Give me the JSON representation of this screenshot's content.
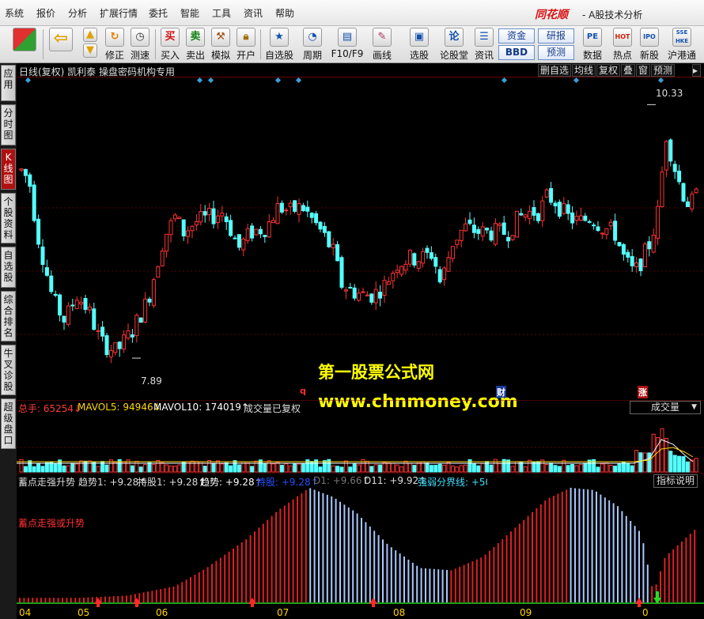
{
  "menu": [
    "系统",
    "报价",
    "分析",
    "扩展行情",
    "委托",
    "智能",
    "工具",
    "资讯",
    "帮助"
  ],
  "brand": "同花顺",
  "app_title": "- A股技术分析",
  "toolbar": {
    "items": [
      "修正",
      "测速",
      "买入",
      "卖出",
      "模拟",
      "开户",
      "自选股",
      "周期",
      "F10/F9",
      "画线",
      "选股",
      "论股堂",
      "资讯",
      "数据",
      "热点",
      "新股",
      "沪港通"
    ],
    "buy_glyph": "买",
    "sell_glyph": "卖",
    "lun_glyph": "论",
    "zijin": "资金",
    "bbd": "BBD",
    "yanbao": "研报",
    "yuce": "预测",
    "pe_glyph": "PE",
    "hot_glyph": "HOT",
    "ipo_glyph": "IPO",
    "hk_glyph": "SSE HKE"
  },
  "sidebar": [
    "应用",
    "分时图",
    "K线图",
    "个股资料",
    "自选股",
    "综合排名",
    "牛叉诊股",
    "超级盘口"
  ],
  "chart_header": {
    "title": "日线(复权) 凯利泰 操盘密码机构专用",
    "buttons": [
      "删自选",
      "均线",
      "复权",
      "叠",
      "窗",
      "预测"
    ]
  },
  "kline": {
    "high_label": "10.33",
    "low_label": "7.89",
    "markers": [
      {
        "text": "q",
        "color": "#ff3030"
      },
      {
        "text": "财",
        "color": "#ffffff"
      },
      {
        "text": "涨",
        "color": "#ffffff"
      }
    ]
  },
  "volume": {
    "legend": [
      {
        "text": "总手: 65254↓",
        "color": "#ff3c3c"
      },
      {
        "text": "MAVOL5: 94946↓",
        "color": "#ffd700"
      },
      {
        "text": "MAVOL10: 174019↑",
        "color": "#ffffff"
      },
      {
        "text": "成交量已复权",
        "color": "#dddddd"
      }
    ],
    "select_label": "成交量"
  },
  "indicator": {
    "legend": [
      {
        "text": "蓄点走强升势",
        "color": "#dddddd"
      },
      {
        "text": "趋势1: +9.28↑",
        "color": "#dddddd"
      },
      {
        "text": "持股1: +9.28↑",
        "color": "#dddddd"
      },
      {
        "text": "趋势: +9.28↑",
        "color": "#ffffff"
      },
      {
        "text": "持股: +9.28↑",
        "color": "#2850ff"
      },
      {
        "text": "D1: +9.66↑",
        "color": "#777777"
      },
      {
        "text": "D11: +9.92↑",
        "color": "#dddddd"
      },
      {
        "text": "强弱分界线: +50",
        "color": "#40e0ff"
      }
    ],
    "note": "蓄点走强或升势",
    "explain_label": "指标说明"
  },
  "x_axis_labels": [
    "04",
    "05",
    "06",
    "07",
    "08",
    "09",
    "0"
  ],
  "watermark": {
    "line1": "第一股票公式网",
    "line2": "www.chnmoney.com"
  },
  "colors": {
    "up": "#ff3232",
    "down": "#54ffff",
    "ma_white": "#ffffff",
    "ma_yellow": "#ffd700",
    "grid": "#5a0000"
  }
}
